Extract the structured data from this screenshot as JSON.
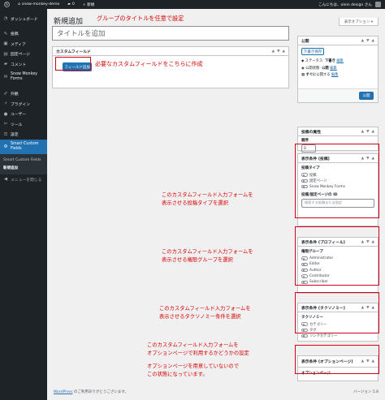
{
  "adminbar": {
    "site_name": "snow-monkey-demo",
    "comments_count": "0",
    "new_label": "+ 新規",
    "greeting": "こんにちは、olein design さん"
  },
  "sidebar": {
    "items": [
      {
        "label": "ダッシュボード",
        "icon": "dashboard-icon"
      },
      {
        "label": "投稿",
        "icon": "pin-icon"
      },
      {
        "label": "メディア",
        "icon": "media-icon"
      },
      {
        "label": "固定ページ",
        "icon": "page-icon"
      },
      {
        "label": "コメント",
        "icon": "comment-icon"
      },
      {
        "label": "Snow Monkey Forms",
        "icon": "forms-icon"
      },
      {
        "label": "外観",
        "icon": "appearance-icon"
      },
      {
        "label": "プラグイン",
        "icon": "plugin-icon"
      },
      {
        "label": "ユーザー",
        "icon": "user-icon"
      },
      {
        "label": "ツール",
        "icon": "tools-icon"
      },
      {
        "label": "設定",
        "icon": "settings-icon"
      },
      {
        "label": "Smart Custom Fields",
        "icon": "gear-icon"
      }
    ],
    "submenu": [
      "Smart Custom Fields",
      "新規追加"
    ],
    "collapse_label": "メニューを閉じる"
  },
  "page": {
    "title": "新規追加",
    "screen_options": "表示オプション ▾",
    "title_placeholder": "タイトルを追加"
  },
  "custom_fields_box": {
    "title": "カスタムフィールド",
    "add_button": "フィールド追加"
  },
  "publish_box": {
    "title": "公開",
    "save_draft": "下書き保存",
    "status_label": "ステータス:",
    "status_value": "下書き",
    "status_edit": "編集",
    "visibility_label": "公開状態:",
    "visibility_value": "公開",
    "visibility_edit": "編集",
    "schedule_label": "すぐに",
    "schedule_suffix": "公開する",
    "schedule_edit": "編集",
    "publish_button": "公開"
  },
  "attributes_box": {
    "title": "投稿の属性",
    "order_label": "順序",
    "order_value": "0"
  },
  "conditions_post": {
    "title": "表示条件 (投稿)",
    "post_type_label": "投稿タイプ",
    "post_types": [
      "投稿",
      "固定ページ",
      "Snow Monkey Forms"
    ],
    "id_label": "投稿/固定ページの ID",
    "search_placeholder": "検索する投稿または固定"
  },
  "conditions_profile": {
    "title": "表示条件 (プロフィール)",
    "role_label": "権限グループ",
    "roles": [
      "Administrator",
      "Editor",
      "Author",
      "Contributor",
      "Subscriber"
    ]
  },
  "conditions_taxonomy": {
    "title": "表示条件 (タクソノミー)",
    "taxonomy_label": "タクソノミー",
    "taxonomies": [
      "カテゴリー",
      "タグ",
      "リンクカテゴリー"
    ]
  },
  "conditions_options": {
    "title": "表示条件 (オプションページ)",
    "options_label": "オプションページ"
  },
  "annotations": {
    "title_note": "グループのタイトルを任意で設定",
    "add_field_note": "必要なカスタムフィールドをこちらに作成",
    "post_note_1": "このカスタムフィールド入力フォームを",
    "post_note_2": "表示させる投稿タイプを選択",
    "profile_note_1": "このカスタムフィールド入力フォームを",
    "profile_note_2": "表示させる権限グループを選択",
    "taxonomy_note_1": "このカスタムフィールド入力フォームを",
    "taxonomy_note_2": "表示させるタクソノミー条件を選択",
    "options_note_1": "このカスタムフィールド入力フォームを",
    "options_note_2": "オプションページで利用するかどうかの設定",
    "options_note_3": "オプションページを用意していないので",
    "options_note_4": "この状態になっています。"
  },
  "footer": {
    "left_link": "WordPress",
    "left_text": " のご利用ありがとうございます。",
    "version": "バージョン 5.8"
  },
  "colors": {
    "annotation_red": "#d80000",
    "wp_blue": "#2271b1",
    "admin_dark": "#1d2327"
  }
}
